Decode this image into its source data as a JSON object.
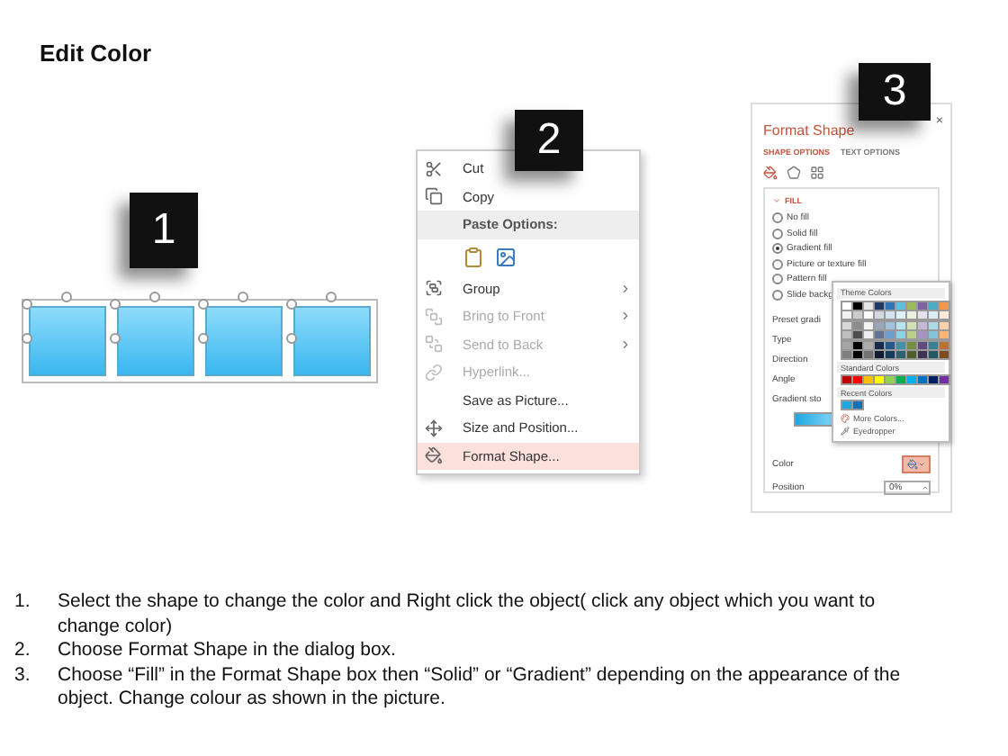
{
  "title": "Edit Color",
  "shapes_panel": {
    "badge": "1",
    "shapes": [
      {
        "selected": true
      },
      {
        "selected": true
      },
      {
        "selected": true
      },
      {
        "selected": true
      }
    ]
  },
  "context_menu": {
    "badge": "2",
    "items": [
      {
        "kind": "item",
        "label": "Cut",
        "disabled": false,
        "submenu": false,
        "selected": false
      },
      {
        "kind": "item",
        "label": "Copy",
        "disabled": false,
        "submenu": false,
        "selected": false
      },
      {
        "kind": "header",
        "label": "Paste Options:"
      },
      {
        "kind": "paste_icons"
      },
      {
        "kind": "item",
        "label": "Group",
        "disabled": false,
        "submenu": true,
        "selected": false
      },
      {
        "kind": "item",
        "label": "Bring to Front",
        "disabled": true,
        "submenu": true,
        "selected": false
      },
      {
        "kind": "item",
        "label": "Send to Back",
        "disabled": true,
        "submenu": true,
        "selected": false
      },
      {
        "kind": "item",
        "label": "Hyperlink...",
        "disabled": true,
        "submenu": false,
        "selected": false
      },
      {
        "kind": "item",
        "label": "Save as Picture...",
        "disabled": false,
        "submenu": false,
        "selected": false
      },
      {
        "kind": "item",
        "label": "Size and Position...",
        "disabled": false,
        "submenu": false,
        "selected": false
      },
      {
        "kind": "item",
        "label": "Format Shape...",
        "disabled": false,
        "submenu": false,
        "selected": true
      }
    ]
  },
  "format_pane": {
    "badge": "3",
    "title": "Format Shape",
    "close": "×",
    "tabs": [
      {
        "label": "SHAPE OPTIONS",
        "selected": true
      },
      {
        "label": "TEXT OPTIONS",
        "selected": false
      }
    ],
    "section": "FILL",
    "section_expanded": true,
    "fill_options": [
      {
        "label": "No fill",
        "selected": false
      },
      {
        "label": "Solid fill",
        "selected": false
      },
      {
        "label": "Gradient fill",
        "selected": true
      },
      {
        "label": "Picture or texture fill",
        "selected": false
      },
      {
        "label": "Pattern fill",
        "selected": false
      },
      {
        "label": "Slide backg",
        "selected": false
      }
    ],
    "properties": [
      {
        "label": "Preset gradi"
      },
      {
        "label": "Type"
      },
      {
        "label": "Direction"
      },
      {
        "label": "Angle"
      },
      {
        "label": "Gradient sto"
      }
    ],
    "color_label": "Color",
    "position_label": "Position",
    "position_value": "0%",
    "color_picker": {
      "theme_heading": "Theme Colors",
      "theme_colors": [
        {
          "color": "#ffffff"
        },
        {
          "color": "#000000"
        },
        {
          "color": "#e7e6e6"
        },
        {
          "color": "#1f3864"
        },
        {
          "color": "#2e75b6"
        },
        {
          "color": "#5bc0de"
        },
        {
          "color": "#9bbb59"
        },
        {
          "color": "#8064a2"
        },
        {
          "color": "#4bacc6"
        },
        {
          "color": "#f79646"
        }
      ],
      "standard_heading": "Standard Colors",
      "standard_colors": [
        {
          "color": "#c00000"
        },
        {
          "color": "#ff0000"
        },
        {
          "color": "#ffc000"
        },
        {
          "color": "#ffff00"
        },
        {
          "color": "#92d050"
        },
        {
          "color": "#00b050"
        },
        {
          "color": "#00b0f0"
        },
        {
          "color": "#0070c0"
        },
        {
          "color": "#002060"
        },
        {
          "color": "#7030a0"
        }
      ],
      "recent_heading": "Recent Colors",
      "recent_colors": [
        {
          "color": "#1fa6e0"
        },
        {
          "color": "#1a6fae"
        }
      ],
      "actions": [
        {
          "kind": "more",
          "label": "More Colors..."
        },
        {
          "kind": "eyedropper",
          "label": "Eyedropper"
        }
      ]
    }
  },
  "instructions": [
    {
      "number": "1.",
      "text": "Select the shape to change the color and Right click the object( click any object which you want to change color)"
    },
    {
      "number": "2.",
      "text": "Choose Format Shape in the dialog box."
    },
    {
      "number": "3.",
      "text": "Choose “Fill” in the Format Shape box then “Solid” or “Gradient” depending on the appearance of the object. Change colour as shown in the picture."
    }
  ]
}
